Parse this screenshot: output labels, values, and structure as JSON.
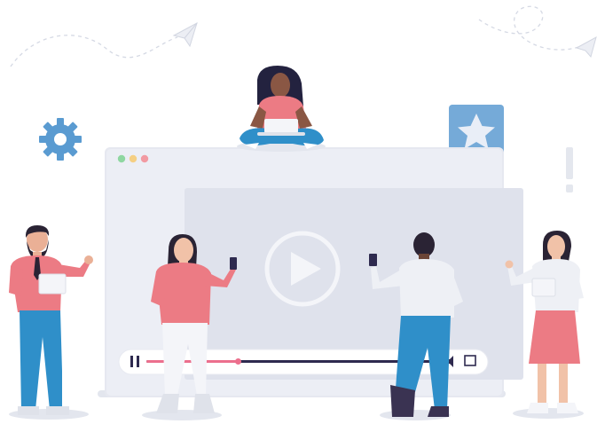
{
  "colors": {
    "window_frame": "#e9ebf3",
    "window_inner": "#dde0ea",
    "video_panel": "#d9dce8",
    "dot_green": "#8fd7a1",
    "dot_yellow": "#f5cf83",
    "dot_red": "#f29aa2",
    "play_ring": "#f2f3f8",
    "progress_played": "#ec6f8d",
    "progress_remaining": "#2e2a4f",
    "pink_shirt": "#ec7b84",
    "blue_pants": "#2f8fc9",
    "gear": "#5a9bd1",
    "star_badge": "#5a9bd1"
  },
  "icons": {
    "gear": "gear-icon",
    "star": "star-icon",
    "play": "play-icon",
    "pause": "pause-icon",
    "volume": "volume-icon",
    "fullscreen": "fullscreen-icon",
    "paper_plane": "paper-plane-icon",
    "exclamation": "exclamation-icon"
  },
  "player": {
    "progress": 0.31
  }
}
